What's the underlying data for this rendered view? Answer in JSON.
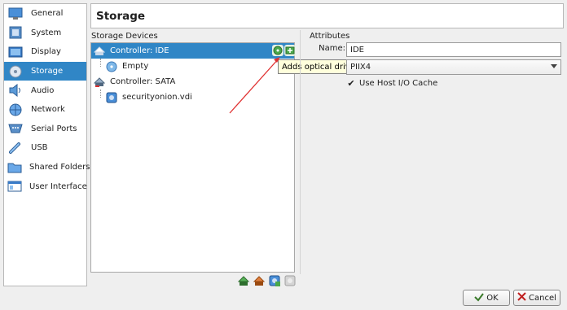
{
  "sidebar": {
    "items": [
      {
        "label": "General",
        "icon": "monitor-icon",
        "active": false
      },
      {
        "label": "System",
        "icon": "chip-icon",
        "active": false
      },
      {
        "label": "Display",
        "icon": "display-icon",
        "active": false
      },
      {
        "label": "Storage",
        "icon": "storage-icon",
        "active": true
      },
      {
        "label": "Audio",
        "icon": "speaker-icon",
        "active": false
      },
      {
        "label": "Network",
        "icon": "network-icon",
        "active": false
      },
      {
        "label": "Serial Ports",
        "icon": "serial-port-icon",
        "active": false
      },
      {
        "label": "USB",
        "icon": "usb-icon",
        "active": false
      },
      {
        "label": "Shared Folders",
        "icon": "folder-icon",
        "active": false
      },
      {
        "label": "User Interface",
        "icon": "window-icon",
        "active": false
      }
    ]
  },
  "header": {
    "title": "Storage"
  },
  "storage_devices": {
    "label": "Storage Devices",
    "tree": [
      {
        "label": "Controller: IDE",
        "kind": "controller"
      },
      {
        "label": "Empty",
        "kind": "optical"
      },
      {
        "label": "Controller: SATA",
        "kind": "controller"
      },
      {
        "label": "securityonion.vdi",
        "kind": "disk"
      }
    ],
    "tooltip": "Adds optical drive."
  },
  "attributes": {
    "label": "Attributes",
    "name_label": "Name:",
    "name_value": "IDE",
    "type_value": "PIIX4",
    "cache_label": "Use Host I/O Cache",
    "cache_checked": true
  },
  "buttons": {
    "ok": "OK",
    "cancel": "Cancel"
  },
  "colors": {
    "selection": "#3086c6",
    "arrow": "#e03030"
  }
}
